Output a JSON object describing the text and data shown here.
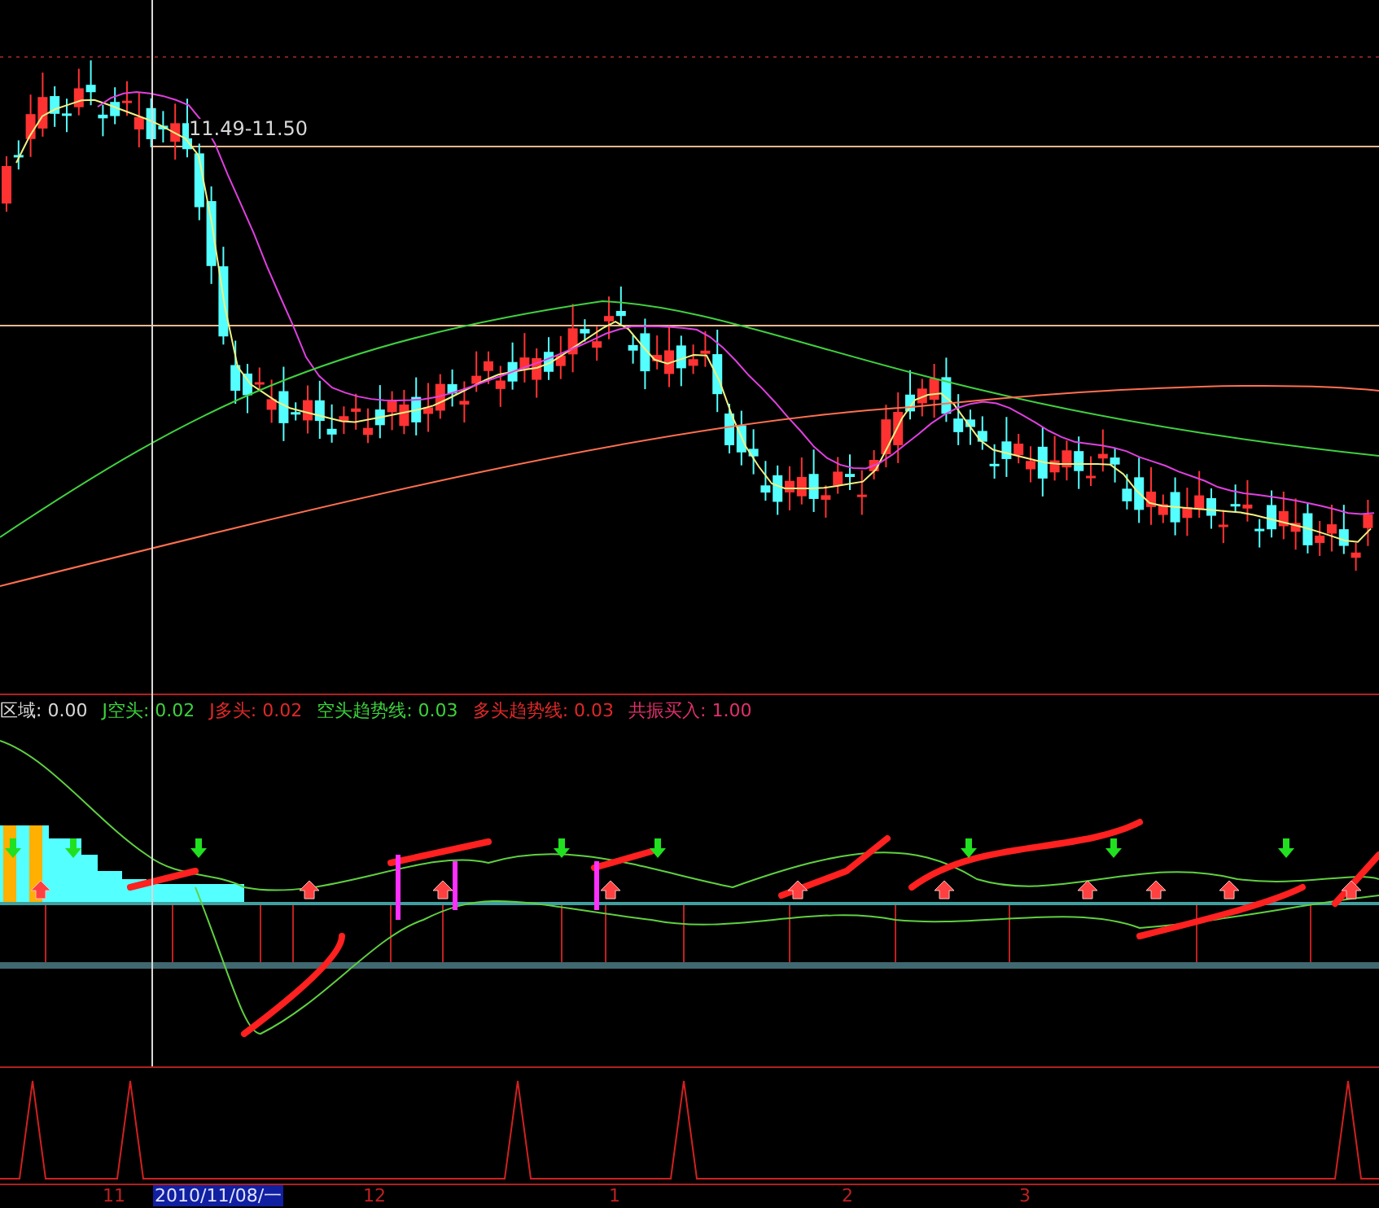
{
  "price_panel": {
    "crosshair_label": "11.49-11.50"
  },
  "indicator_panel": {
    "legend": [
      {
        "label": "区域: 0.00",
        "color": "#d8d8d8"
      },
      {
        "label": "J空头: 0.02",
        "color": "#3cd23c"
      },
      {
        "label": "J多头: 0.02",
        "color": "#e02828"
      },
      {
        "label": "空头趋势线: 0.03",
        "color": "#3cd23c"
      },
      {
        "label": "多头趋势线: 0.03",
        "color": "#e02828"
      },
      {
        "label": "共振买入: 1.00",
        "color": "#e0306e"
      }
    ]
  },
  "time_axis": {
    "labels": [
      {
        "text": "11",
        "selected": false
      },
      {
        "text": "2010/11/08/一",
        "selected": true
      },
      {
        "text": "12",
        "selected": false
      },
      {
        "text": "1",
        "selected": false
      },
      {
        "text": "2",
        "selected": false
      },
      {
        "text": "3",
        "selected": false
      }
    ]
  }
}
